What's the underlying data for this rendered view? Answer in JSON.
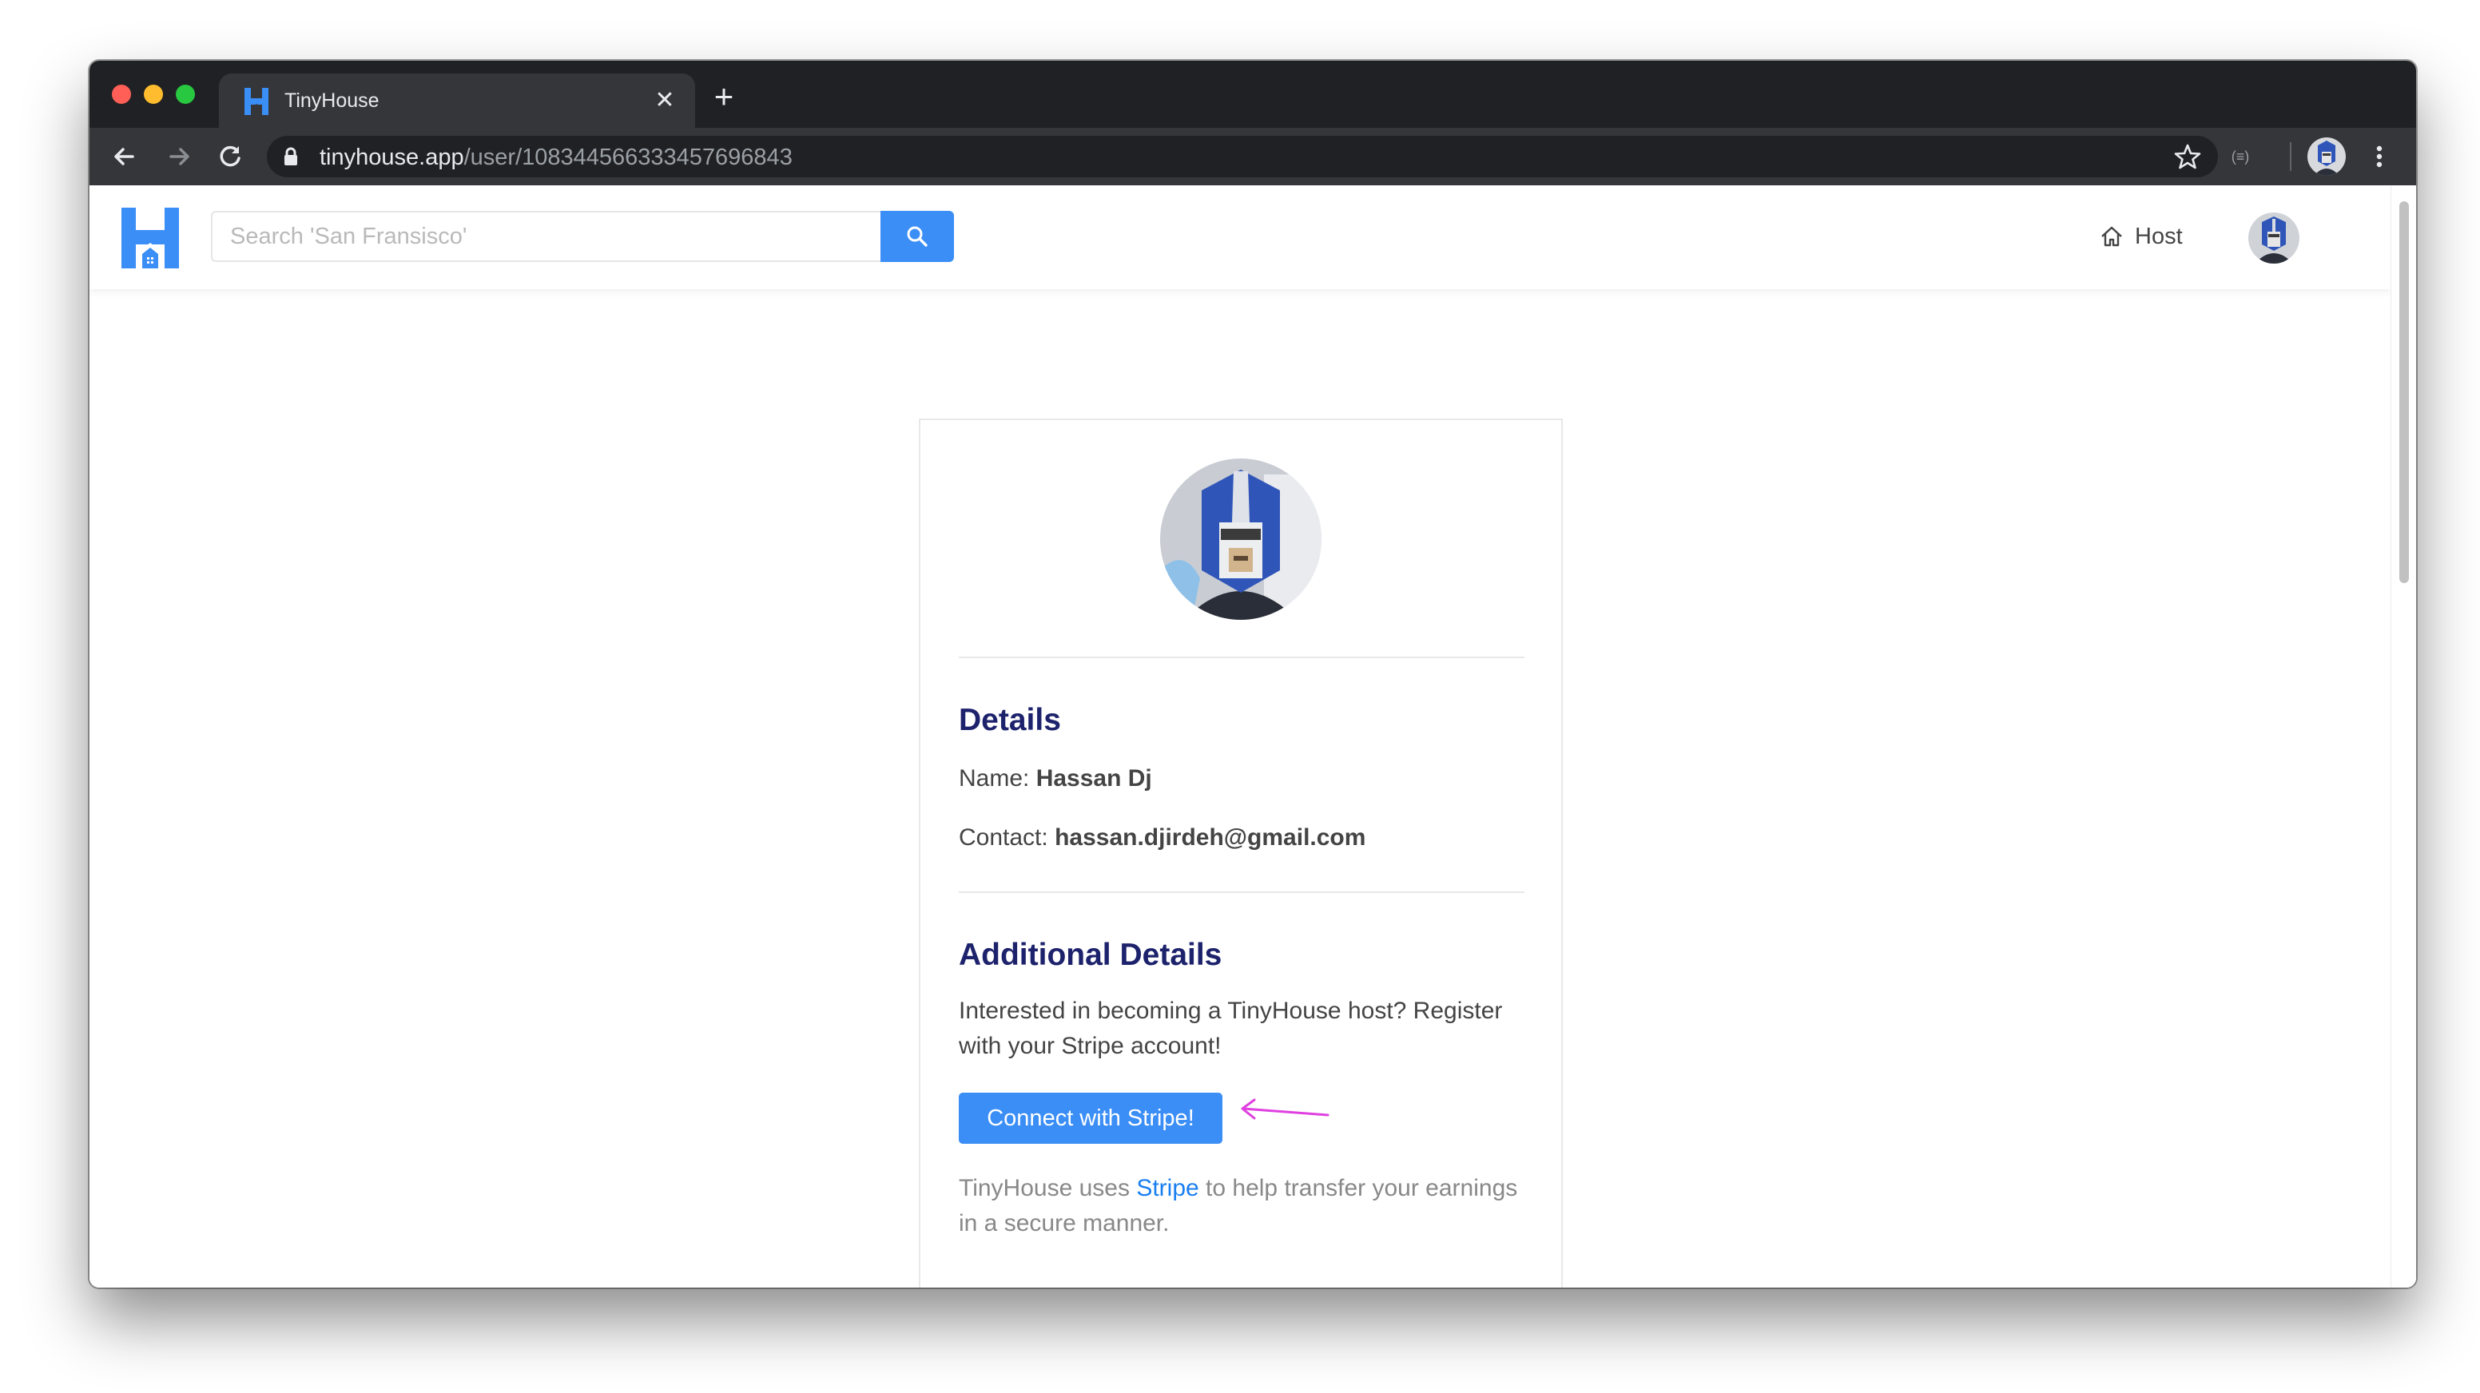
{
  "browser": {
    "tab_title": "TinyHouse",
    "tab_close_glyph": "✕",
    "new_tab_glyph": "+",
    "url_domain": "tinyhouse.app",
    "url_path": "/user/108344566333457696843",
    "extension_label": "(≡)",
    "icons": {
      "back": "arrow-left-icon",
      "forward": "arrow-right-icon",
      "reload": "reload-icon",
      "lock": "lock-icon",
      "bookmark": "star-icon",
      "menu": "kebab-icon"
    }
  },
  "header": {
    "search_placeholder": "Search 'San Fransisco'",
    "host_label": "Host",
    "colors": {
      "brand": "#3a8ef6"
    }
  },
  "profile": {
    "details_title": "Details",
    "name_label": "Name:",
    "name_value": "Hassan Dj",
    "contact_label": "Contact:",
    "contact_value": "hassan.djirdeh@gmail.com",
    "additional_title": "Additional Details",
    "host_prompt": "Interested in becoming a TinyHouse host? Register with your Stripe account!",
    "stripe_button_label": "Connect with Stripe!",
    "footnote_prefix": "TinyHouse uses ",
    "footnote_link": "Stripe",
    "footnote_suffix": " to help transfer your earnings in a secure manner.",
    "colors": {
      "title": "#1d226c",
      "link": "#1a7ff0",
      "annotation": "#e040e0"
    }
  }
}
